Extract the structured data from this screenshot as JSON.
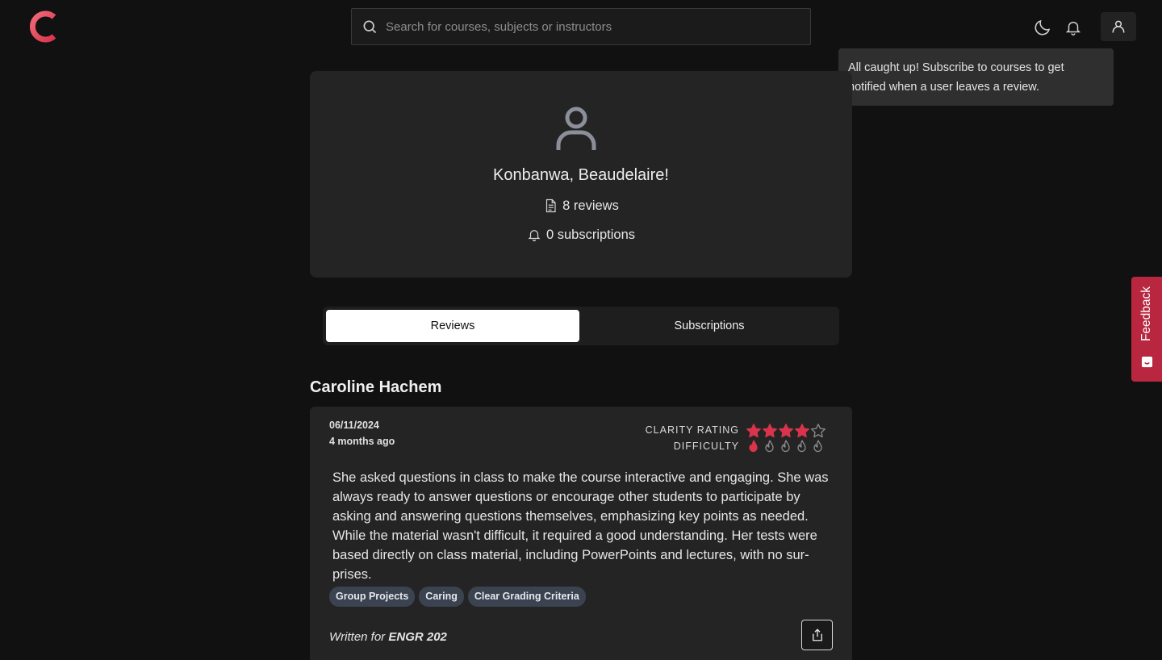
{
  "header": {
    "search_placeholder": "Search for courses, subjects or instructors",
    "notification_message": "All caught up! Subscribe to courses to get notified when a user leaves a review."
  },
  "profile": {
    "greeting": "Konbanwa, Beaudelaire!",
    "reviews_count": "8 reviews",
    "subscriptions_count": "0 subscriptions"
  },
  "tabs": [
    {
      "label": "Reviews",
      "active": true
    },
    {
      "label": "Subscriptions",
      "active": false
    }
  ],
  "review": {
    "instructor": "Caroline Hachem",
    "date": "06/11/2024",
    "relative_time": "4 months ago",
    "clarity_label": "CLARITY RATING",
    "clarity_value": 4,
    "clarity_max": 5,
    "difficulty_label": "DIFFICULTY",
    "difficulty_value": 1,
    "difficulty_max": 5,
    "text": "She asked questions in class to make the course interactive and engaging. She was always ready to answer questions or encourage other students to participate by asking and answering questions themselves, emphasizing key points as needed. While the material wasn't difficult, it required a good understanding. Her tests were based directly on class material, including PowerPoints and lectures, with no sur­prises.",
    "tags": [
      "Group Projects",
      "Caring",
      "Clear Grading Criteria"
    ],
    "written_for_prefix": "Written for",
    "course": "ENGR 202"
  },
  "feedback": {
    "label": "Feedback"
  },
  "colors": {
    "brand": "#e04a5c",
    "accent_red": "#d8344c",
    "feedback_bg": "#b8263f",
    "background": "#111111",
    "card": "#242424"
  }
}
